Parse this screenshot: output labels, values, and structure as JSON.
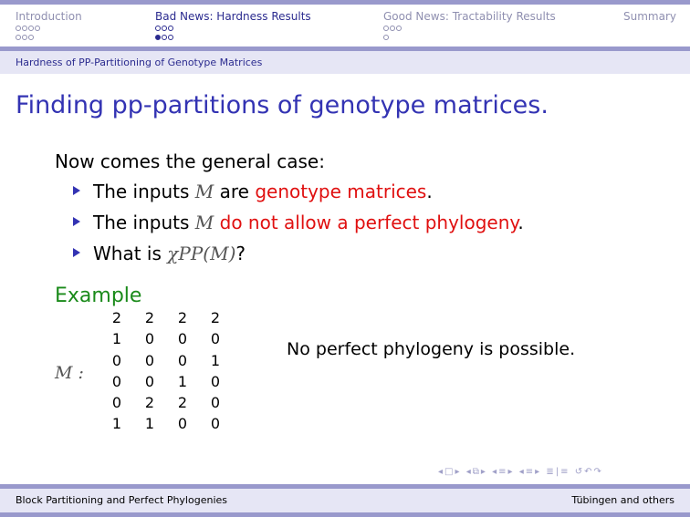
{
  "nav": {
    "sections": [
      {
        "label": "Introduction",
        "dots": "○○○○\n○○○"
      },
      {
        "label": "Bad News: Hardness Results",
        "dots": "○○○\n●○○"
      },
      {
        "label": "Good News: Tractability Results",
        "dots": "○○○\n○"
      },
      {
        "label": "Summary",
        "dots": ""
      }
    ]
  },
  "subsection": "Hardness of PP-Partitioning of Genotype Matrices",
  "frame_title": "Finding pp-partitions of genotype matrices.",
  "intro": "Now comes the general case:",
  "bullets": [
    {
      "prefix": "The inputs ",
      "math": "M",
      "middle": " are ",
      "highlight": "genotype matrices",
      "suffix": "."
    },
    {
      "prefix": "The inputs ",
      "math": "M",
      "middle": " ",
      "highlight": "do not allow a perfect phylogeny",
      "suffix": "."
    },
    {
      "prefix": "What is ",
      "math": "χPP(M)",
      "middle": "",
      "highlight": "",
      "suffix": "?"
    }
  ],
  "example": {
    "title": "Example",
    "label": "M :",
    "matrix": [
      [
        "2",
        "2",
        "2",
        "2"
      ],
      [
        "1",
        "0",
        "0",
        "0"
      ],
      [
        "0",
        "0",
        "0",
        "1"
      ],
      [
        "0",
        "0",
        "1",
        "0"
      ],
      [
        "0",
        "2",
        "2",
        "0"
      ],
      [
        "1",
        "1",
        "0",
        "0"
      ]
    ],
    "note": "No perfect phylogeny is possible."
  },
  "footer": {
    "left": "Block Partitioning and Perfect Phylogenies",
    "right": "Tübingen and others"
  },
  "colors": {
    "title": "#3333b3",
    "alert": "#e01010",
    "example": "#1a8a1a",
    "band": "#9999cc"
  }
}
